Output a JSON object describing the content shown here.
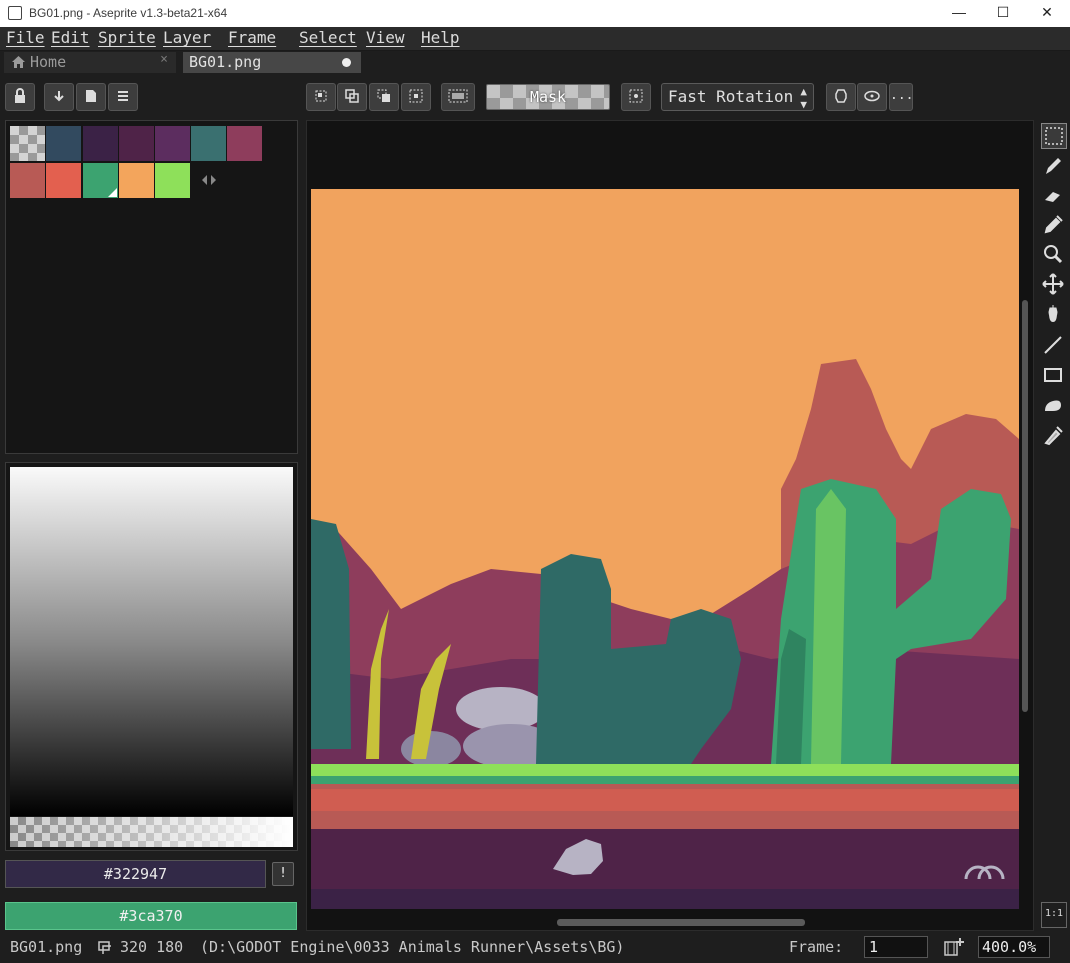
{
  "window": {
    "title": "BG01.png - Aseprite v1.3-beta21-x64",
    "minimize": "—",
    "maximize": "☐",
    "close": "✕"
  },
  "menu": [
    "File",
    "Edit",
    "Sprite",
    "Layer",
    "Frame",
    "Select",
    "View",
    "Help"
  ],
  "tabs": {
    "home": "Home",
    "home_close": "×",
    "file": "BG01.png"
  },
  "toolbar": {
    "mask_label": "Mask",
    "rotation_mode": "Fast Rotation",
    "more": "..."
  },
  "palette": {
    "colors": [
      "#324a5f",
      "#3b2246",
      "#4f2348",
      "#5c2d5f",
      "#3a7070",
      "#8e3d5c",
      "#b85a55",
      "#e3604f",
      "#3ca370",
      "#f3a55c",
      "#8ee05a"
    ]
  },
  "colors": {
    "foreground": "#322947",
    "background": "#3ca370"
  },
  "warn_icon": "!",
  "status": {
    "filename": "BG01.png",
    "size": "320 180",
    "path": "(D:\\GODOT Engine\\0033 Animals Runner\\Assets\\BG)",
    "frame_label": "Frame:",
    "frame_value": "1",
    "zoom": "400.0%"
  },
  "zoom_one_to_one": "1:1"
}
